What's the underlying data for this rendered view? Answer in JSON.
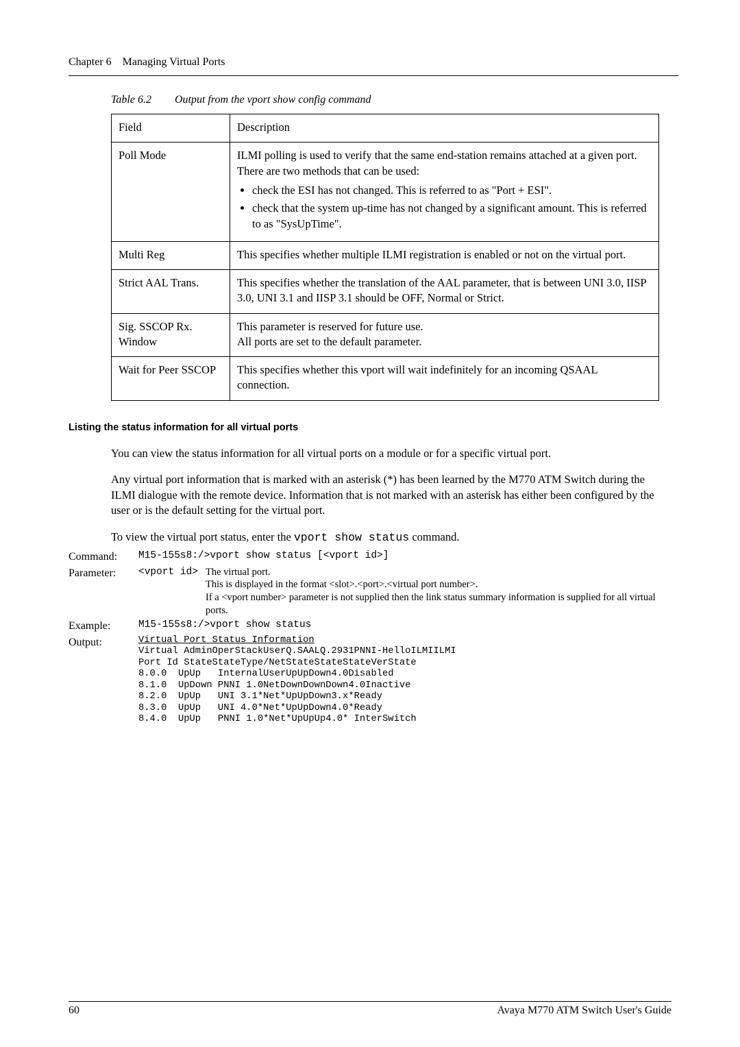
{
  "runningHead": {
    "chapter": "Chapter 6",
    "title": "Managing Virtual Ports"
  },
  "tableCaption": {
    "num": "Table 6.2",
    "title": "Output from the vport show config command"
  },
  "table": {
    "headers": [
      "Field",
      "Description"
    ],
    "rows": [
      {
        "field": "Poll Mode",
        "descIntro": "ILMI polling is used to verify that the same end-station remains attached at a given port. There are two methods that can be used:",
        "bullets": [
          "check the ESI has not changed. This is referred to as \"Port + ESI\".",
          "check that the system up-time has not changed by a significant amount. This is referred to as \"SysUpTime\"."
        ]
      },
      {
        "field": "Multi Reg",
        "desc": "This specifies whether multiple ILMI registration is enabled or not on the virtual port."
      },
      {
        "field": "Strict AAL Trans.",
        "desc": "This specifies whether the translation of the AAL parameter, that is between UNI 3.0, IISP 3.0, UNI 3.1 and IISP 3.1 should be OFF, Normal or Strict."
      },
      {
        "field": "Sig. SSCOP Rx. Window",
        "desc": "This parameter is reserved for future use.\nAll ports are set to the default parameter."
      },
      {
        "field": "Wait for Peer SSCOP",
        "desc": "This specifies whether this vport will wait indefinitely for an incoming QSAAL connection."
      }
    ]
  },
  "section": {
    "heading": "Listing the status information for all virtual ports",
    "p1": "You can view the status information for all virtual ports on a module or for a specific virtual port.",
    "p2": "Any virtual port information that is marked with an asterisk (*) has been learned by the M770 ATM Switch during the ILMI dialogue with the remote device. Information that is not marked with an asterisk has either been configured by the user or is the default setting for the virtual port.",
    "p3a": "To view the virtual port status, enter the ",
    "p3cmd": "vport show status",
    "p3b": " command."
  },
  "cmd": {
    "commandLabel": "Command:",
    "commandText": "M15-155s8:/>vport show status [<vport id>]",
    "parameterLabel": "Parameter:",
    "paramName": "<vport id>",
    "paramDesc": "The virtual port.\nThis is displayed in the format <slot>.<port>.<virtual port number>.\nIf a <vport number> parameter is not supplied then the link status summary information is supplied for all virtual ports.",
    "exampleLabel": "Example:",
    "exampleText": "M15-155s8:/>vport show status",
    "outputLabel": "Output:",
    "outputTitle": "Virtual Port Status Information",
    "outputBody": "Virtual AdminOperStackUserQ.SAALQ.2931PNNI-HelloILMIILMI\nPort Id StateStateType/NetStateStateStateVerState\n8.0.0  UpUp   InternalUserUpUpDown4.0Disabled\n8.1.0  UpDown PNNI 1.0NetDownDownDown4.0Inactive\n8.2.0  UpUp   UNI 3.1*Net*UpUpDown3.x*Ready\n8.3.0  UpUp   UNI 4.0*Net*UpUpDown4.0*Ready\n8.4.0  UpUp   PNNI 1.0*Net*UpUpUp4.0* InterSwitch"
  },
  "footer": {
    "pageNum": "60",
    "bookTitle": "Avaya M770 ATM Switch User's Guide"
  }
}
